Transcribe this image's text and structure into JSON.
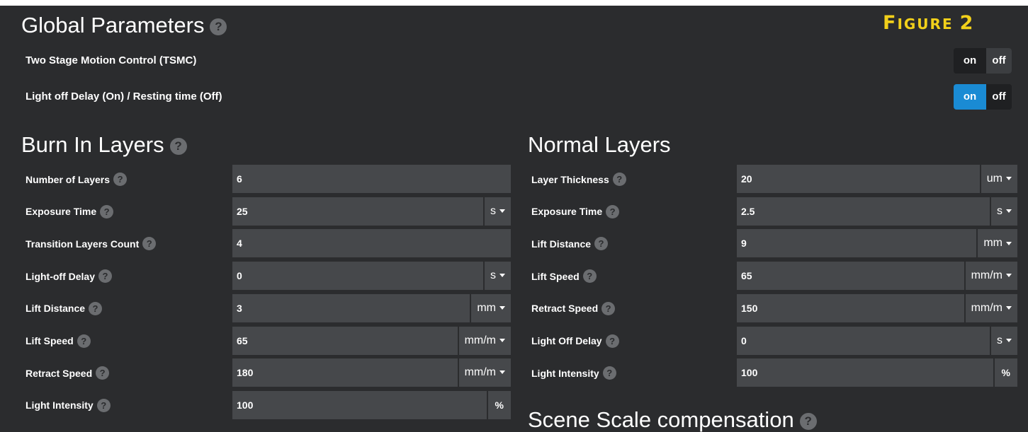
{
  "global": {
    "title": "Global Parameters",
    "figure_label_prefix": "F",
    "figure_label_rest": "IGURE",
    "figure_label_num": "2",
    "toggles": [
      {
        "label": "Two Stage Motion Control (TSMC)",
        "on": "on",
        "off": "off",
        "state": "off"
      },
      {
        "label": "Light off Delay (On) / Resting time (Off)",
        "on": "on",
        "off": "off",
        "state": "on"
      }
    ]
  },
  "burn_in": {
    "title": "Burn In Layers",
    "rows": [
      {
        "label": "Number of Layers",
        "value": "6",
        "unit": ""
      },
      {
        "label": "Exposure Time",
        "value": "25",
        "unit": "s"
      },
      {
        "label": "Transition Layers Count",
        "value": "4",
        "unit": ""
      },
      {
        "label": "Light-off Delay",
        "value": "0",
        "unit": "s"
      },
      {
        "label": "Lift Distance",
        "value": "3",
        "unit": "mm"
      },
      {
        "label": "Lift Speed",
        "value": "65",
        "unit": "mm/m"
      },
      {
        "label": "Retract Speed",
        "value": "180",
        "unit": "mm/m"
      },
      {
        "label": "Light Intensity",
        "value": "100",
        "unit": "%"
      }
    ]
  },
  "normal": {
    "title": "Normal Layers",
    "rows": [
      {
        "label": "Layer Thickness",
        "value": "20",
        "unit": "um"
      },
      {
        "label": "Exposure Time",
        "value": "2.5",
        "unit": "s"
      },
      {
        "label": "Lift Distance",
        "value": "9",
        "unit": "mm"
      },
      {
        "label": "Lift Speed",
        "value": "65",
        "unit": "mm/m"
      },
      {
        "label": "Retract Speed",
        "value": "150",
        "unit": "mm/m"
      },
      {
        "label": "Light Off Delay",
        "value": "0",
        "unit": "s"
      },
      {
        "label": "Light Intensity",
        "value": "100",
        "unit": "%"
      }
    ]
  },
  "scene_scale": {
    "title": "Scene Scale compensation"
  },
  "help_glyph": "?",
  "colors": {
    "background": "#2b2c2e",
    "field": "#46484b",
    "toggle_active": "#1a8bd4",
    "figure_label": "#f2d01a"
  }
}
